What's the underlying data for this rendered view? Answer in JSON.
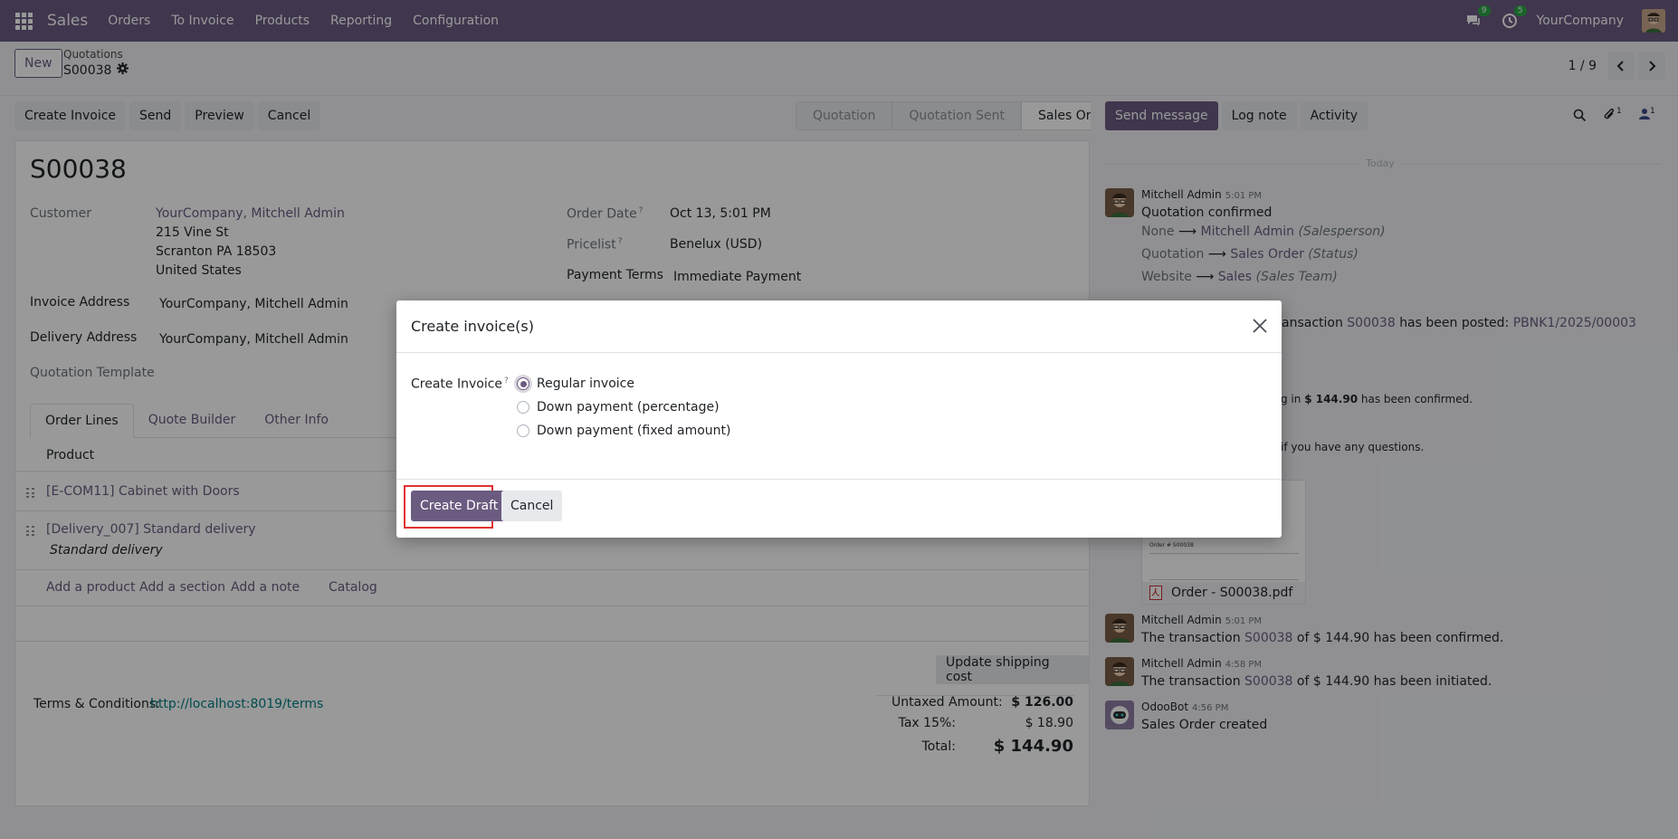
{
  "navbar": {
    "brand": "Sales",
    "menu": [
      "Orders",
      "To Invoice",
      "Products",
      "Reporting",
      "Configuration"
    ],
    "messages_badge": "9",
    "activities_badge": "5",
    "company": "YourCompany"
  },
  "control": {
    "new_label": "New",
    "breadcrumb_parent": "Quotations",
    "breadcrumb_current": "S00038",
    "pager_value": "1 / 9"
  },
  "actions": {
    "create_invoice": "Create Invoice",
    "send": "Send",
    "preview": "Preview",
    "cancel": "Cancel"
  },
  "status": {
    "steps": [
      "Quotation",
      "Quotation Sent",
      "Sales Order"
    ],
    "active": "Sales Order"
  },
  "form": {
    "name": "S00038",
    "customer_label": "Customer",
    "customer_name": "YourCompany, Mitchell Admin",
    "customer_street": "215 Vine St",
    "customer_city": "Scranton PA 18503",
    "customer_country": "United States",
    "invoice_address_label": "Invoice Address",
    "invoice_address": "YourCompany, Mitchell Admin",
    "delivery_address_label": "Delivery Address",
    "delivery_address": "YourCompany, Mitchell Admin",
    "quotation_template_label": "Quotation Template",
    "order_date_label": "Order Date",
    "order_date": "Oct 13, 5:01 PM",
    "pricelist_label": "Pricelist",
    "pricelist": "Benelux (USD)",
    "payment_terms_label": "Payment Terms",
    "payment_terms": "Immediate Payment",
    "tabs": [
      "Order Lines",
      "Quote Builder",
      "Other Info"
    ],
    "product_header": "Product",
    "lines": [
      {
        "product": "[E-COM11] Cabinet with Doors"
      },
      {
        "product": "[Delivery_007] Standard delivery",
        "description": "Standard delivery"
      }
    ],
    "add_product": "Add a product",
    "add_section": "Add a section",
    "add_note": "Add a note",
    "catalog": "Catalog",
    "update_shipping": "Update shipping cost",
    "terms_label": "Terms & Conditions:",
    "terms_link": "http://localhost:8019/terms",
    "untaxed_label": "Untaxed Amount:",
    "untaxed_value": "$ 126.00",
    "tax_label": "Tax 15%:",
    "tax_value": "$ 18.90",
    "total_label": "Total:",
    "total_value": "$ 144.90"
  },
  "chatter": {
    "send_message": "Send message",
    "log_note": "Log note",
    "activity": "Activity",
    "attachments_count": "1",
    "followers_count": "1",
    "today": "Today",
    "m1": {
      "author": "Mitchell Admin",
      "time": "5:01 PM",
      "body": "Quotation confirmed",
      "c1_old": "None",
      "c1_new": "Mitchell Admin",
      "c1_field": "(Salesperson)",
      "c2_old": "Quotation",
      "c2_new": "Sales Order",
      "c2_field": "(Status)",
      "c3_old": "Website",
      "c3_new": "Sales",
      "c3_field": "(Sales Team)"
    },
    "m2_pre": "ansaction",
    "m2_link": "S00038",
    "m2_mid": "has been posted:",
    "m2_ref": "PBNK1/2025/00003",
    "m3_pre": "g in",
    "m3_amount": "$ 144.90",
    "m3_post": "has been confirmed.",
    "m4_text": "if you have any questions.",
    "attachment_title": "Order # S00038",
    "attachment_name": "Order - S00038.pdf",
    "m5": {
      "author": "Mitchell Admin",
      "time": "5:01 PM",
      "pre": "The transaction",
      "link": "S00038",
      "post": "of $ 144.90 has been confirmed."
    },
    "m6": {
      "author": "Mitchell Admin",
      "time": "4:58 PM",
      "pre": "The transaction",
      "link": "S00038",
      "post": "of $ 144.90 has been initiated."
    },
    "m7": {
      "author": "OdooBot",
      "time": "4:56 PM",
      "body": "Sales Order created"
    }
  },
  "dialog": {
    "title": "Create invoice(s)",
    "field_label": "Create Invoice",
    "options": [
      "Regular invoice",
      "Down payment (percentage)",
      "Down payment (fixed amount)"
    ],
    "selected": "Regular invoice",
    "create_draft": "Create Draft",
    "cancel": "Cancel"
  },
  "colors": {
    "brand": "#6b5b80",
    "link_teal": "#017e84",
    "highlight": "#e03131"
  }
}
